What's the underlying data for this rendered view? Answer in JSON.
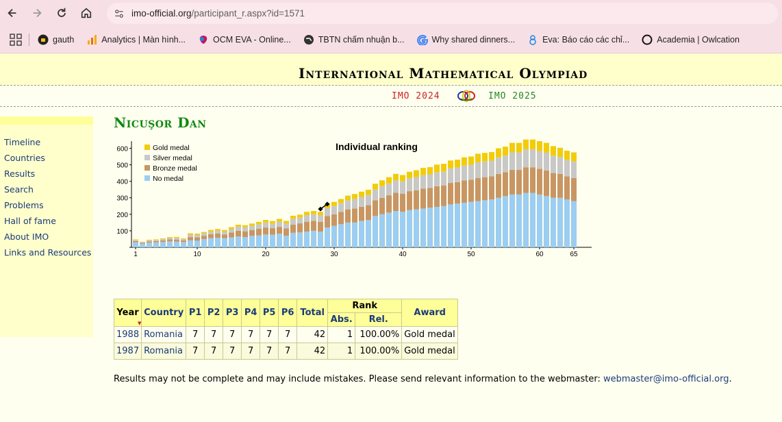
{
  "browser": {
    "url_host": "imo-official.org",
    "url_path": "/participant_r.aspx?id=1571",
    "bookmarks": [
      {
        "label": "gauth",
        "icon": "gauth-icon"
      },
      {
        "label": "Analytics | Màn hình...",
        "icon": "analytics-icon"
      },
      {
        "label": "OCM EVA - Online...",
        "icon": "ocm-eva-icon"
      },
      {
        "label": "TBTN chấm nhuận b...",
        "icon": "globe-icon"
      },
      {
        "label": "Why shared dinners...",
        "icon": "google-icon"
      },
      {
        "label": "Eva: Báo cáo các chỉ...",
        "icon": "eva-icon"
      },
      {
        "label": "Academia | Owlcation",
        "icon": "circle-icon"
      }
    ]
  },
  "site": {
    "title": "International Mathematical Olympiad",
    "prev_link": "IMO 2024",
    "next_link": "IMO 2025"
  },
  "sidebar": {
    "items": [
      "Timeline",
      "Countries",
      "Results",
      "Search",
      "Problems",
      "Hall of fame",
      "About IMO",
      "Links and Resources"
    ]
  },
  "participant": {
    "name": "Nicuşor Dan"
  },
  "chart_data": {
    "type": "bar",
    "title": "Individual ranking",
    "stacked": true,
    "x_ticks": [
      "1",
      "10",
      "20",
      "30",
      "40",
      "50",
      "60",
      "65"
    ],
    "y_ticks": [
      "100",
      "200",
      "300",
      "400",
      "500",
      "600"
    ],
    "ylim": [
      0,
      660
    ],
    "legend_position": "top-left",
    "colors": {
      "gold": "#f2cc0c",
      "silver": "#c8c8c8",
      "bronze": "#c89664",
      "none": "#9ccdf2"
    },
    "series": [
      {
        "name": "No medal",
        "values": [
          30,
          22,
          28,
          30,
          32,
          36,
          35,
          32,
          42,
          40,
          50,
          55,
          58,
          55,
          60,
          65,
          62,
          70,
          72,
          78,
          76,
          82,
          70,
          88,
          90,
          95,
          100,
          95,
          120,
          130,
          140,
          150,
          150,
          160,
          165,
          190,
          200,
          210,
          220,
          215,
          225,
          230,
          235,
          240,
          245,
          250,
          260,
          265,
          270,
          275,
          280,
          285,
          290,
          300,
          310,
          320,
          320,
          330,
          330,
          320,
          310,
          300,
          300,
          290,
          280
        ]
      },
      {
        "name": "Bronze medal",
        "values": [
          8,
          6,
          8,
          8,
          10,
          12,
          12,
          10,
          20,
          20,
          20,
          25,
          25,
          22,
          30,
          35,
          35,
          35,
          40,
          42,
          40,
          42,
          45,
          50,
          55,
          60,
          60,
          60,
          70,
          70,
          75,
          80,
          85,
          85,
          90,
          95,
          100,
          105,
          110,
          110,
          115,
          115,
          120,
          120,
          125,
          125,
          130,
          130,
          135,
          135,
          140,
          140,
          140,
          145,
          145,
          150,
          150,
          155,
          155,
          155,
          155,
          150,
          145,
          140,
          140
        ]
      },
      {
        "name": "Silver medal",
        "values": [
          6,
          4,
          6,
          6,
          8,
          8,
          10,
          8,
          15,
          15,
          15,
          15,
          18,
          18,
          20,
          25,
          25,
          25,
          28,
          30,
          28,
          32,
          30,
          35,
          35,
          40,
          40,
          40,
          48,
          50,
          52,
          55,
          58,
          60,
          62,
          65,
          70,
          72,
          75,
          75,
          78,
          80,
          82,
          82,
          85,
          85,
          88,
          88,
          90,
          90,
          95,
          95,
          95,
          100,
          100,
          105,
          105,
          108,
          108,
          108,
          108,
          105,
          102,
          100,
          100
        ]
      },
      {
        "name": "Gold medal",
        "values": [
          4,
          2,
          4,
          4,
          4,
          6,
          6,
          4,
          8,
          8,
          8,
          10,
          10,
          10,
          12,
          12,
          12,
          14,
          14,
          16,
          15,
          16,
          15,
          18,
          18,
          20,
          20,
          20,
          24,
          25,
          26,
          28,
          30,
          32,
          32,
          35,
          36,
          38,
          40,
          38,
          40,
          42,
          44,
          44,
          46,
          46,
          48,
          48,
          50,
          50,
          52,
          52,
          52,
          55,
          55,
          58,
          58,
          60,
          60,
          60,
          60,
          58,
          56,
          55,
          55
        ]
      }
    ],
    "participant_markers": [
      {
        "x": 28,
        "y": 232
      },
      {
        "x": 29,
        "y": 262
      }
    ]
  },
  "results": {
    "headers": {
      "year": "Year",
      "country": "Country",
      "p1": "P1",
      "p2": "P2",
      "p3": "P3",
      "p4": "P4",
      "p5": "P5",
      "p6": "P6",
      "total": "Total",
      "rank": "Rank",
      "abs": "Abs.",
      "rel": "Rel.",
      "award": "Award"
    },
    "rows": [
      {
        "year": "1988",
        "country": "Romania",
        "p1": "7",
        "p2": "7",
        "p3": "7",
        "p4": "7",
        "p5": "7",
        "p6": "7",
        "total": "42",
        "abs": "1",
        "rel": "100.00%",
        "award": "Gold medal"
      },
      {
        "year": "1987",
        "country": "Romania",
        "p1": "7",
        "p2": "7",
        "p3": "7",
        "p4": "7",
        "p5": "7",
        "p6": "7",
        "total": "42",
        "abs": "1",
        "rel": "100.00%",
        "award": "Gold medal"
      }
    ]
  },
  "footer": {
    "text": "Results may not be complete and may include mistakes. Please send relevant information to the webmaster: ",
    "email": "webmaster@imo-official.org",
    "end": "."
  }
}
